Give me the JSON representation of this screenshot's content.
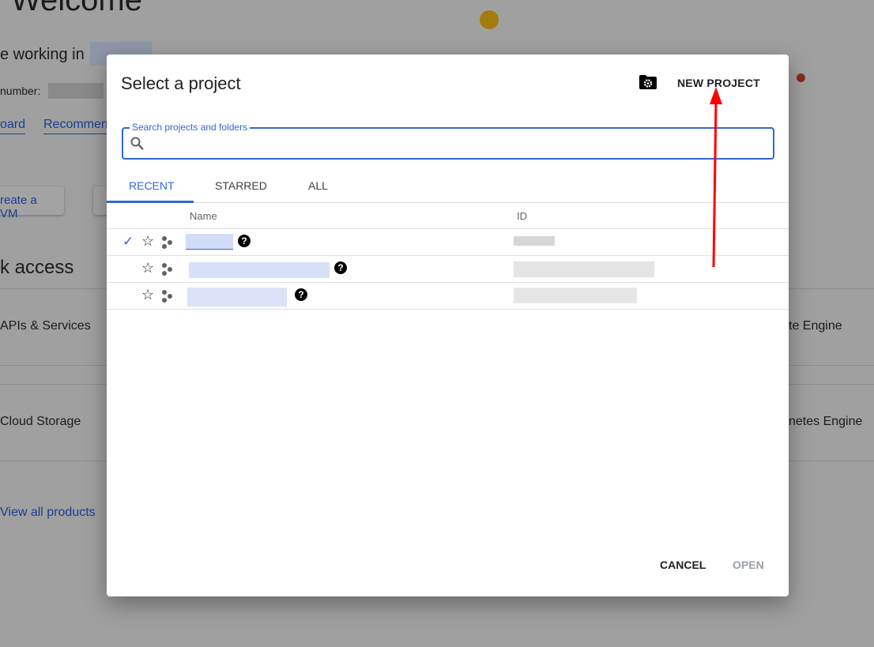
{
  "background": {
    "welcome": "Welcome",
    "working_in": "e working in",
    "number_label": "number:",
    "links": [
      "oard",
      "Recommen"
    ],
    "buttons": [
      "reate a VM"
    ],
    "quick_access": "k access",
    "products_left": [
      "APIs & Services",
      "Cloud Storage"
    ],
    "products_right": [
      "te Engine",
      "netes Engine"
    ],
    "view_all": "View all products"
  },
  "dialog": {
    "title": "Select a project",
    "new_project": "NEW PROJECT",
    "search": {
      "label": "Search projects and folders",
      "value": "",
      "placeholder": ""
    },
    "tabs": [
      {
        "label": "RECENT",
        "active": true
      },
      {
        "label": "STARRED"
      },
      {
        "label": "ALL"
      }
    ],
    "columns": [
      "Name",
      "ID"
    ],
    "rows": [
      {
        "selected": true
      },
      {
        "selected": false
      },
      {
        "selected": false
      }
    ],
    "cancel": "CANCEL",
    "open": "OPEN"
  },
  "colors": {
    "accent": "#3367d6",
    "annotation_arrow": "#ff0000"
  }
}
